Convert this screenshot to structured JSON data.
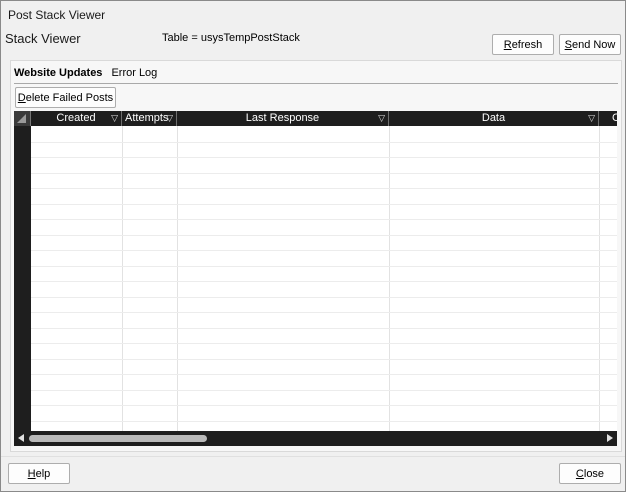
{
  "window": {
    "title": "Post Stack Viewer"
  },
  "header": {
    "title": "Stack Viewer",
    "table_label": "Table = usysTempPostStack"
  },
  "toolbar": {
    "refresh": {
      "accel": "R",
      "rest": "efresh"
    },
    "send_now": {
      "accel": "S",
      "rest": "end Now"
    }
  },
  "tabs": [
    {
      "label": "Website Updates",
      "active": true
    },
    {
      "label": "Error Log",
      "active": false
    }
  ],
  "actions": {
    "delete_failed": {
      "accel": "D",
      "rest": "elete Failed Posts"
    }
  },
  "grid": {
    "columns": [
      "Created",
      "Attempts",
      "Last Response",
      "Data",
      "C"
    ],
    "rows": []
  },
  "footer": {
    "help": {
      "accel": "H",
      "rest": "elp"
    },
    "close": {
      "accel": "C",
      "rest": "lose"
    }
  },
  "icons": {
    "sort": "filter-triangle-icon",
    "select_all": "select-all-corner-icon",
    "scroll_left": "arrow-left-icon",
    "scroll_right": "arrow-right-icon"
  }
}
